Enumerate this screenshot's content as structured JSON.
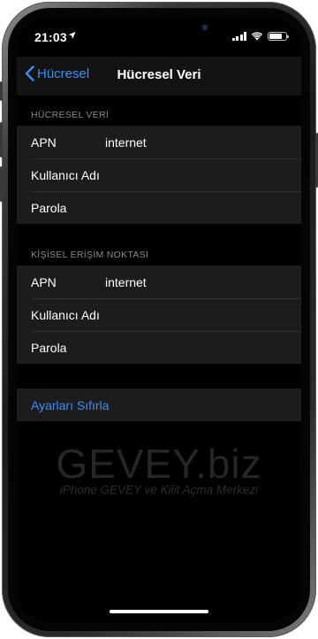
{
  "status_bar": {
    "time": "21:03",
    "battery_level": 0.8
  },
  "nav": {
    "back_label": "Hücresel",
    "title": "Hücresel Veri"
  },
  "sections": [
    {
      "header": "HÜCRESEL VERİ",
      "rows": [
        {
          "label": "APN",
          "value": "internet"
        },
        {
          "label": "Kullanıcı Adı",
          "value": ""
        },
        {
          "label": "Parola",
          "value": ""
        }
      ]
    },
    {
      "header": "KİŞİSEL ERİŞİM NOKTASI",
      "rows": [
        {
          "label": "APN",
          "value": "internet"
        },
        {
          "label": "Kullanıcı Adı",
          "value": ""
        },
        {
          "label": "Parola",
          "value": ""
        }
      ]
    }
  ],
  "reset_label": "Ayarları Sıfırla",
  "watermark": {
    "main": "GEVEY.biz",
    "sub": "iPhone GEVEY ve Kilit Açma Merkezi"
  },
  "colors": {
    "accent": "#3e8ef7",
    "background": "#000000",
    "cell": "#1c1c1e"
  }
}
